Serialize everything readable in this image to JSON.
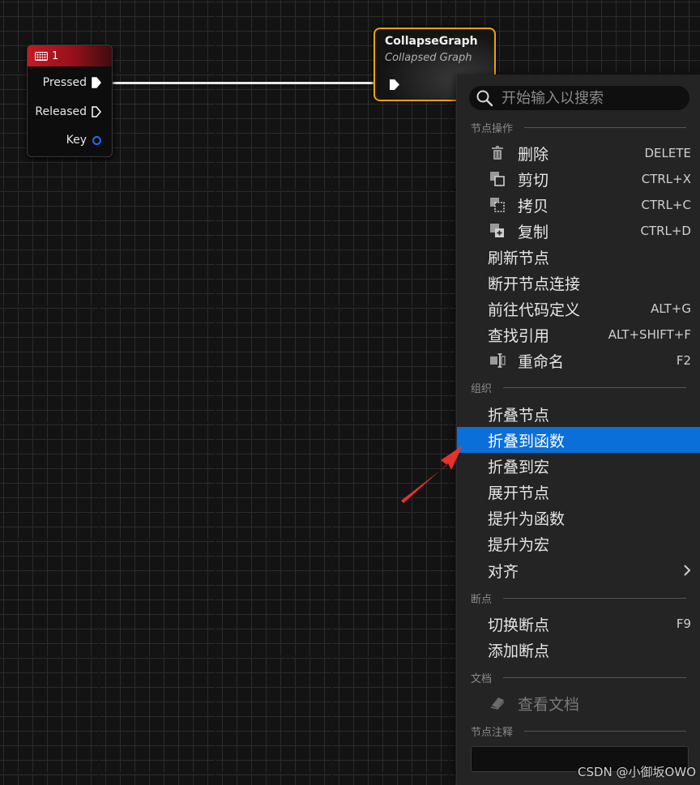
{
  "key_node": {
    "title": "1",
    "pins": {
      "pressed": "Pressed",
      "released": "Released",
      "key": "Key"
    }
  },
  "collapsed_node": {
    "title": "CollapseGraph",
    "subtitle": "Collapsed Graph"
  },
  "menu": {
    "search_placeholder": "开始输入以搜索",
    "sections": {
      "node_actions": "节点操作",
      "organize": "组织",
      "breakpoints": "断点",
      "docs": "文档",
      "node_comment": "节点注释"
    },
    "items": {
      "delete": {
        "label": "删除",
        "shortcut": "DELETE"
      },
      "cut": {
        "label": "剪切",
        "shortcut": "CTRL+X"
      },
      "copy": {
        "label": "拷贝",
        "shortcut": "CTRL+C"
      },
      "duplicate": {
        "label": "复制",
        "shortcut": "CTRL+D"
      },
      "refresh": {
        "label": "刷新节点"
      },
      "break_links": {
        "label": "断开节点连接"
      },
      "goto_code": {
        "label": "前往代码定义",
        "shortcut": "ALT+G"
      },
      "find_refs": {
        "label": "查找引用",
        "shortcut": "ALT+SHIFT+F"
      },
      "rename": {
        "label": "重命名",
        "shortcut": "F2"
      },
      "collapse_nodes": {
        "label": "折叠节点"
      },
      "collapse_function": {
        "label": "折叠到函数"
      },
      "collapse_macro": {
        "label": "折叠到宏"
      },
      "expand_node": {
        "label": "展开节点"
      },
      "promote_function": {
        "label": "提升为函数"
      },
      "promote_macro": {
        "label": "提升为宏"
      },
      "alignment": {
        "label": "对齐"
      },
      "toggle_breakpoint": {
        "label": "切换断点",
        "shortcut": "F9"
      },
      "add_breakpoint": {
        "label": "添加断点"
      },
      "view_docs": {
        "label": "查看文档"
      }
    }
  },
  "colors": {
    "selected": "#0a6fd8",
    "node_border": "#f0a400",
    "key_header": "#c41a24",
    "annotation_arrow": "#e8322c"
  },
  "watermark": "CSDN @小御坂OWO"
}
